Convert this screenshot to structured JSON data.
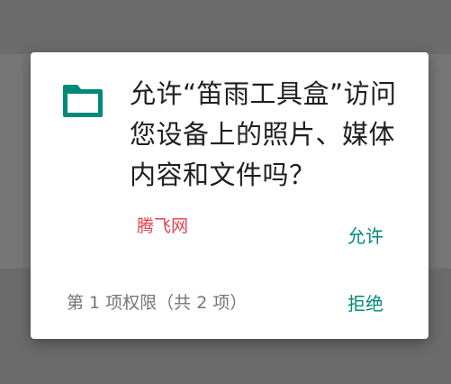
{
  "dialog": {
    "icon": "folder-icon",
    "title": "允许“笛雨工具盒”访问您设备上的照片、媒体内容和文件吗？",
    "watermark": "腾飞网",
    "allow_label": "允许",
    "permission_counter": "第 1 项权限（共 2 项）",
    "deny_label": "拒绝"
  },
  "colors": {
    "accent": "#00897b",
    "watermark": "#e0424a",
    "scrim": "#6b6b6b"
  }
}
